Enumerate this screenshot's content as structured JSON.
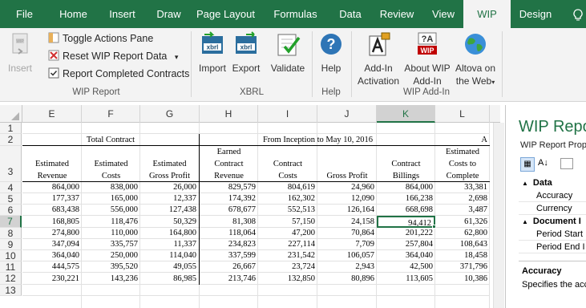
{
  "tabs": [
    {
      "label": "File"
    },
    {
      "label": "Home"
    },
    {
      "label": "Insert"
    },
    {
      "label": "Draw"
    },
    {
      "label": "Page Layout"
    },
    {
      "label": "Formulas"
    },
    {
      "label": "Data"
    },
    {
      "label": "Review"
    },
    {
      "label": "View"
    },
    {
      "label": "WIP",
      "active": true
    },
    {
      "label": "Design"
    }
  ],
  "ribbon": {
    "insert_label": "Insert",
    "toggle_actions": "Toggle Actions Pane",
    "reset_wip": "Reset WIP Report Data",
    "report_completed": "Report Completed Contracts",
    "report_completed_checked": true,
    "group_wip_report": "WIP Report",
    "import_label": "Import",
    "export_label": "Export",
    "validate_label": "Validate",
    "group_xbrl": "XBRL",
    "help_label": "Help",
    "group_help": "Help",
    "addin_activation_l1": "Add-In",
    "addin_activation_l2": "Activation",
    "about_wip_l1": "About WIP",
    "about_wip_l2": "Add-In",
    "altova_l1": "Altova on",
    "altova_l2": "the Web",
    "group_wip_addin": "WIP Add-In",
    "xbrl_text": "xbrl"
  },
  "columns": [
    "E",
    "F",
    "G",
    "H",
    "I",
    "J",
    "K",
    "L"
  ],
  "selected_column": "K",
  "rows": [
    "1",
    "2",
    "3",
    "4",
    "5",
    "6",
    "7",
    "8",
    "9",
    "10",
    "11",
    "12",
    "13"
  ],
  "selected_row": "7",
  "sheet": {
    "total_contract": "Total Contract",
    "from_inception": "From Inception to May 10, 2016",
    "col_l_row2": "A",
    "headers": [
      [
        "",
        "Estimated",
        "Revenue"
      ],
      [
        "",
        "Estimated",
        "Costs"
      ],
      [
        "",
        "Estimated",
        "Gross Profit"
      ],
      [
        "Earned",
        "Contract",
        "Revenue"
      ],
      [
        "",
        "Contract",
        "Costs"
      ],
      [
        "",
        "",
        "Gross Profit"
      ],
      [
        "",
        "Contract",
        "Billings"
      ],
      [
        "Estimated",
        "Costs to",
        "Complete"
      ]
    ],
    "data": [
      [
        "864,000",
        "838,000",
        "26,000",
        "829,579",
        "804,619",
        "24,960",
        "864,000",
        "33,381"
      ],
      [
        "177,337",
        "165,000",
        "12,337",
        "174,392",
        "162,302",
        "12,090",
        "166,238",
        "2,698"
      ],
      [
        "683,438",
        "556,000",
        "127,438",
        "678,677",
        "552,513",
        "126,164",
        "668,698",
        "3,487"
      ],
      [
        "168,805",
        "118,476",
        "50,329",
        "81,308",
        "57,150",
        "24,158",
        "94,412",
        "61,326"
      ],
      [
        "274,800",
        "110,000",
        "164,800",
        "118,064",
        "47,200",
        "70,864",
        "201,222",
        "62,800"
      ],
      [
        "347,094",
        "335,757",
        "11,337",
        "234,823",
        "227,114",
        "7,709",
        "257,804",
        "108,643"
      ],
      [
        "364,040",
        "250,000",
        "114,040",
        "337,599",
        "231,542",
        "106,057",
        "364,040",
        "18,458"
      ],
      [
        "444,575",
        "395,520",
        "49,055",
        "26,667",
        "23,724",
        "2,943",
        "42,500",
        "371,796"
      ],
      [
        "230,221",
        "143,236",
        "86,985",
        "213,746",
        "132,850",
        "80,896",
        "113,605",
        "10,386"
      ]
    ]
  },
  "pane": {
    "title": "WIP Repo",
    "subtitle": "WIP Report Prop",
    "sections": [
      {
        "name": "Data",
        "items": [
          "Accuracy",
          "Currency"
        ]
      },
      {
        "name": "Document I",
        "items": [
          "Period Start",
          "Period End I"
        ]
      }
    ],
    "desc_title": "Accuracy",
    "desc_text": "Specifies the acc"
  },
  "colors": {
    "accent": "#217346",
    "ribbon_bg": "#f3f3f3"
  }
}
